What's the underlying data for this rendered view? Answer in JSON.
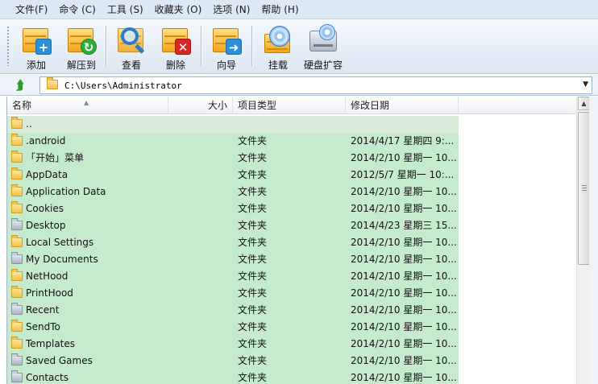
{
  "menu": [
    "文件(F)",
    "命令 (C)",
    "工具 (S)",
    "收藏夹 (O)",
    "选项 (N)",
    "帮助 (H)"
  ],
  "toolbar": {
    "add": "添加",
    "extract": "解压到",
    "view": "查看",
    "delete": "删除",
    "wizard": "向导",
    "mount": "挂载",
    "disk_expand": "硬盘扩容"
  },
  "address": {
    "path": "C:\\Users\\Administrator"
  },
  "list": {
    "columns": {
      "name": "名称",
      "size": "大小",
      "type": "项目类型",
      "modified": "修改日期"
    },
    "rows": [
      {
        "name": "..",
        "type": "",
        "modified": "",
        "icon": "folder-up-icon"
      },
      {
        "name": ".android",
        "type": "文件夹",
        "modified": "2014/4/17 星期四 9:...",
        "icon": "folder-icon"
      },
      {
        "name": "「开始」菜单",
        "type": "文件夹",
        "modified": "2014/2/10 星期一 10...",
        "icon": "folder-icon"
      },
      {
        "name": "AppData",
        "type": "文件夹",
        "modified": "2012/5/7 星期一 10:...",
        "icon": "folder-icon"
      },
      {
        "name": "Application Data",
        "type": "文件夹",
        "modified": "2014/2/10 星期一 10...",
        "icon": "folder-icon"
      },
      {
        "name": "Cookies",
        "type": "文件夹",
        "modified": "2014/2/10 星期一 10...",
        "icon": "folder-icon"
      },
      {
        "name": "Desktop",
        "type": "文件夹",
        "modified": "2014/4/23 星期三 15...",
        "icon": "desktop-folder-icon"
      },
      {
        "name": "Local Settings",
        "type": "文件夹",
        "modified": "2014/2/10 星期一 10...",
        "icon": "folder-icon"
      },
      {
        "name": "My Documents",
        "type": "文件夹",
        "modified": "2014/2/10 星期一 10...",
        "icon": "documents-folder-icon"
      },
      {
        "name": "NetHood",
        "type": "文件夹",
        "modified": "2014/2/10 星期一 10...",
        "icon": "folder-icon"
      },
      {
        "name": "PrintHood",
        "type": "文件夹",
        "modified": "2014/2/10 星期一 10...",
        "icon": "folder-icon"
      },
      {
        "name": "Recent",
        "type": "文件夹",
        "modified": "2014/2/10 星期一 10...",
        "icon": "recent-folder-icon"
      },
      {
        "name": "SendTo",
        "type": "文件夹",
        "modified": "2014/2/10 星期一 10...",
        "icon": "folder-icon"
      },
      {
        "name": "Templates",
        "type": "文件夹",
        "modified": "2014/2/10 星期一 10...",
        "icon": "folder-icon"
      },
      {
        "name": "Saved Games",
        "type": "文件夹",
        "modified": "2014/2/10 星期一 10...",
        "icon": "saved-games-folder-icon"
      },
      {
        "name": "Contacts",
        "type": "文件夹",
        "modified": "2014/2/10 星期一 10...",
        "icon": "contacts-folder-icon"
      }
    ]
  }
}
